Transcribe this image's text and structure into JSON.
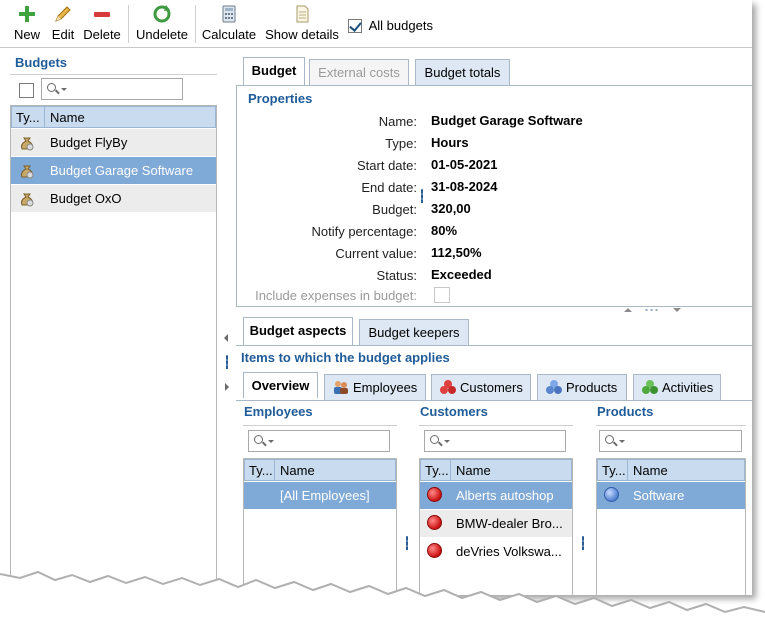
{
  "toolbar": {
    "new_label": "New",
    "edit_label": "Edit",
    "delete_label": "Delete",
    "undelete_label": "Undelete",
    "calculate_label": "Calculate",
    "show_details_label": "Show details",
    "all_budgets_label": "All budgets",
    "all_budgets_checked": true
  },
  "left": {
    "title": "Budgets",
    "grid": {
      "col_type": "Ty...",
      "col_name": "Name",
      "rows": [
        {
          "name": "Budget FlyBy",
          "selected": false
        },
        {
          "name": "Budget Garage Software",
          "selected": true
        },
        {
          "name": "Budget OxO",
          "selected": false
        }
      ]
    }
  },
  "tabs": {
    "budget": "Budget",
    "external_costs": "External costs",
    "budget_totals": "Budget totals"
  },
  "properties": {
    "title": "Properties",
    "name_label": "Name:",
    "name_value": "Budget Garage Software",
    "type_label": "Type:",
    "type_value": "Hours",
    "start_label": "Start date:",
    "start_value": "01-05-2021",
    "end_label": "End date:",
    "end_value": "31-08-2024",
    "budget_label": "Budget:",
    "budget_value": "320,00",
    "notify_label": "Notify percentage:",
    "notify_value": "80%",
    "current_label": "Current value:",
    "current_value": "112,50%",
    "status_label": "Status:",
    "status_value": "Exceeded",
    "include_label": "Include expenses in budget:"
  },
  "aspects": {
    "tab_aspects": "Budget aspects",
    "tab_keepers": "Budget keepers",
    "heading": "Items to which the budget applies",
    "subtabs": {
      "overview": "Overview",
      "employees": "Employees",
      "customers": "Customers",
      "products": "Products",
      "activities": "Activities"
    },
    "employees": {
      "title": "Employees",
      "col_type": "Ty...",
      "col_name": "Name",
      "rows": [
        "[All Employees]"
      ]
    },
    "customers": {
      "title": "Customers",
      "col_type": "Ty...",
      "col_name": "Name",
      "rows": [
        "Alberts autoshop",
        "BMW-dealer Bro...",
        "deVries Volkswa..."
      ]
    },
    "products": {
      "title": "Products",
      "col_type": "Ty...",
      "col_name": "Name",
      "rows": [
        "Software"
      ]
    }
  },
  "colors": {
    "accent_title": "#1f5c99",
    "selection": "#7fa9d6",
    "header": "#c9dcef",
    "tab_inactive": "#dde8f4"
  }
}
